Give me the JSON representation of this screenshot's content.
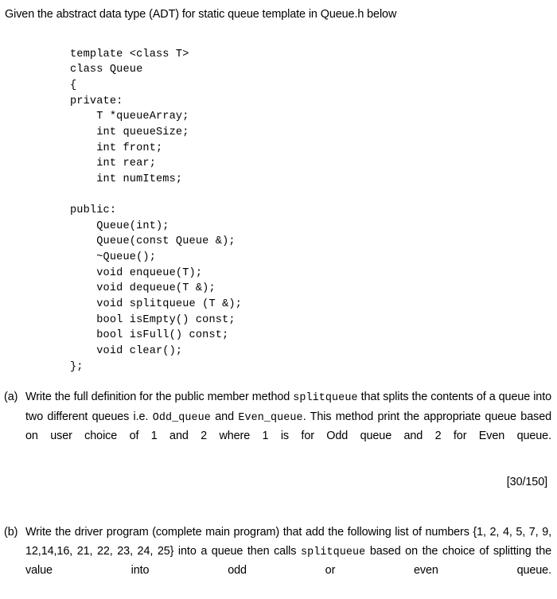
{
  "document": {
    "intro_line": "Given the abstract data type (ADT) for static queue template in Queue.h below",
    "header_file_name": "Queue.h"
  },
  "code_listing": {
    "language": "cpp",
    "lines": [
      "template <class T>",
      "class Queue",
      "{",
      "private:",
      "    T *queueArray;",
      "    int queueSize;",
      "    int front;",
      "    int rear;",
      "    int numItems;",
      "",
      "public:",
      "    Queue(int);",
      "    Queue(const Queue &);",
      "    ~Queue();",
      "    void enqueue(T);",
      "    void dequeue(T &);",
      "    void splitqueue (T &);",
      "    bool isEmpty() const;",
      "    bool isFull() const;",
      "    void clear();",
      "};"
    ]
  },
  "questions": [
    {
      "label": "(a)",
      "segments": [
        {
          "type": "text",
          "value": "Write the full definition for the public member method "
        },
        {
          "type": "code",
          "value": "splitqueue"
        },
        {
          "type": "text",
          "value": " that splits the contents of a queue into two different queues i.e. "
        },
        {
          "type": "code",
          "value": "Odd_queue"
        },
        {
          "type": "text",
          "value": " and "
        },
        {
          "type": "code",
          "value": "Even_queue"
        },
        {
          "type": "text",
          "value": ". This method print the appropriate queue based on user choice of 1 and 2 where 1 is for Odd queue and 2 for Even queue."
        }
      ],
      "marks": "[30/150]"
    },
    {
      "label": "(b)",
      "segments": [
        {
          "type": "text",
          "value": "Write the driver program (complete main program) that add the following list of numbers {1, 2, 4, 5, 7, 9, 12,14,16, 21, 22, 23, 24, 25} into a queue then calls "
        },
        {
          "type": "code",
          "value": "splitqueue"
        },
        {
          "type": "text",
          "value": " based on the choice of splitting the value into odd or even queue."
        }
      ],
      "number_list": [
        1,
        2,
        4,
        5,
        7,
        9,
        12,
        14,
        16,
        21,
        22,
        23,
        24,
        25
      ],
      "marks": ""
    }
  ],
  "colors": {
    "page_background": "#ffffff",
    "text": "#000000"
  }
}
